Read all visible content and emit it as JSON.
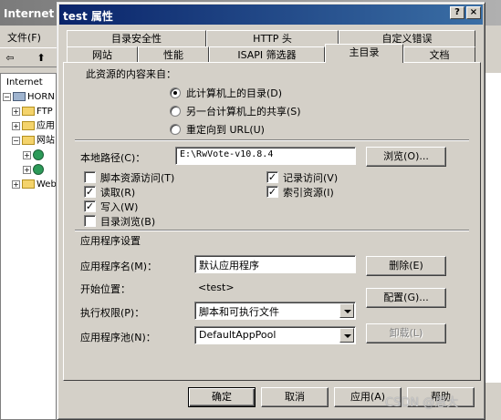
{
  "background": {
    "title": "Internet",
    "menu": {
      "file": "文件(F)"
    },
    "toolbar": {
      "back": "⇦",
      "folder_up": "⬆"
    },
    "tree": [
      {
        "label": "Internet",
        "indent": 0
      },
      {
        "label": "HORN (本",
        "indent": 1
      },
      {
        "label": "FTP",
        "indent": 2
      },
      {
        "label": "应用",
        "indent": 2
      },
      {
        "label": "网站",
        "indent": 2
      },
      {
        "label": "",
        "indent": 3
      },
      {
        "label": "",
        "indent": 3
      },
      {
        "label": "Web",
        "indent": 2
      }
    ]
  },
  "dialog": {
    "title": "test 属性",
    "help_caption": "?",
    "close_caption": "×",
    "tabs_row1": [
      "目录安全性",
      "HTTP 头",
      "自定义错误"
    ],
    "tabs_row2": [
      "网站",
      "性能",
      "ISAPI 筛选器",
      "主目录",
      "文档"
    ],
    "content_source_label": "此资源的内容来自：",
    "radio_options": [
      "此计算机上的目录(D)",
      "另一台计算机上的共享(S)",
      "重定向到 URL(U)"
    ],
    "local_path_label": "本地路径(C)：",
    "local_path_value": "E:\\RwVote-v10.8.4",
    "browse_button": "浏览(O)...",
    "checks_left": [
      {
        "label": "脚本资源访问(T)",
        "checked": false
      },
      {
        "label": "读取(R)",
        "checked": true
      },
      {
        "label": "写入(W)",
        "checked": true
      },
      {
        "label": "目录浏览(B)",
        "checked": false
      }
    ],
    "checks_right": [
      {
        "label": "记录访问(V)",
        "checked": true
      },
      {
        "label": "索引资源(I)",
        "checked": true
      }
    ],
    "app_settings_label": "应用程序设置",
    "app_name_label": "应用程序名(M)：",
    "app_name_value": "默认应用程序",
    "remove_button": "删除(E)",
    "start_point_label": "开始位置：",
    "start_point_value": "<test>",
    "config_button": "配置(G)...",
    "exec_perm_label": "执行权限(P)：",
    "exec_perm_value": "脚本和可执行文件",
    "app_pool_label": "应用程序池(N)：",
    "app_pool_value": "DefaultAppPool",
    "unload_button": "卸载(L)",
    "ok_button": "确定",
    "cancel_button": "取消",
    "apply_button": "应用(A)",
    "help_button": "帮助"
  },
  "watermark": "CSDN @恩大"
}
